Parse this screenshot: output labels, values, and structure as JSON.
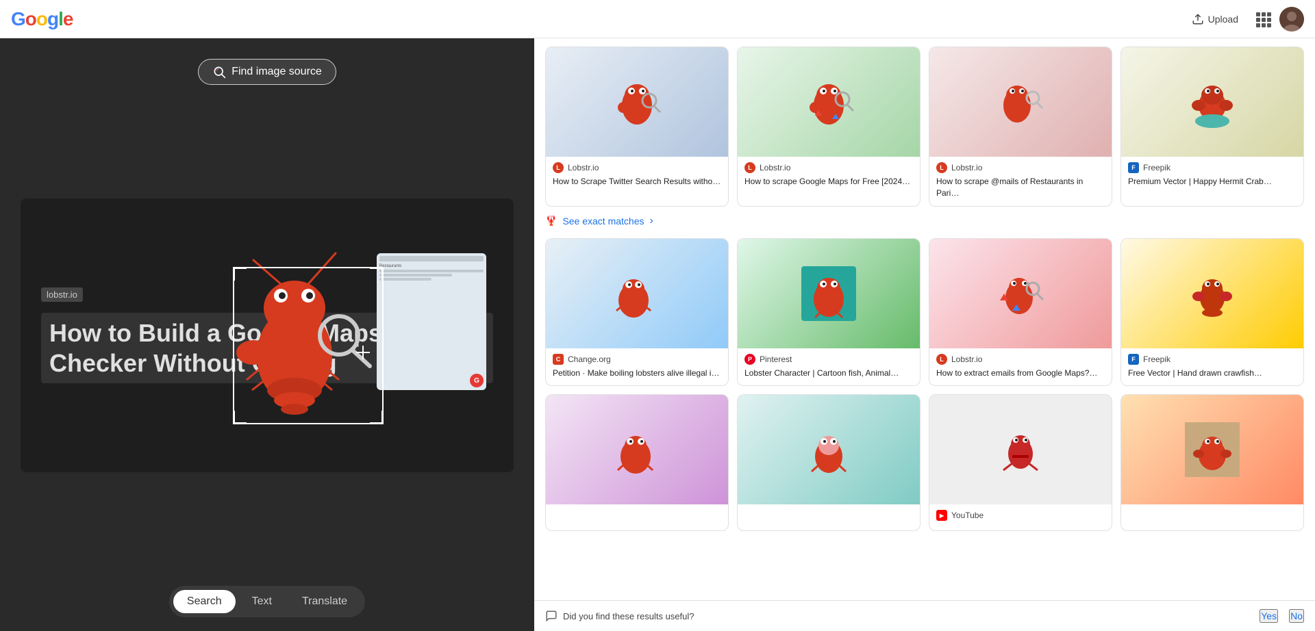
{
  "header": {
    "logo": "Google",
    "logo_letters": [
      "G",
      "o",
      "o",
      "g",
      "l",
      "e"
    ],
    "upload_label": "Upload",
    "upload_icon": "upload-icon",
    "grid_icon": "grid-icon",
    "avatar_icon": "user-avatar"
  },
  "left_panel": {
    "find_image_source_label": "Find image source",
    "image_tag": "lobstr.io",
    "image_headline": "How to Build a Google Maps Rank Checker Without Coding",
    "tabs": [
      {
        "id": "search",
        "label": "Search",
        "active": true
      },
      {
        "id": "text",
        "label": "Text",
        "active": false
      },
      {
        "id": "translate",
        "label": "Translate",
        "active": false
      }
    ]
  },
  "right_panel": {
    "see_exact_matches_label": "See exact matches",
    "results": [
      {
        "id": 1,
        "source_name": "Lobstr.io",
        "title": "How to Scrape Twitter Search Results witho…",
        "favicon_color": "#d63b1f",
        "favicon_letter": "L",
        "bg_class": "img-bg-1"
      },
      {
        "id": 2,
        "source_name": "Lobstr.io",
        "title": "How to scrape Google Maps for Free [2024…",
        "favicon_color": "#d63b1f",
        "favicon_letter": "L",
        "bg_class": "img-bg-2"
      },
      {
        "id": 3,
        "source_name": "Lobstr.io",
        "title": "How to scrape @mails of Restaurants in Pari…",
        "favicon_color": "#d63b1f",
        "favicon_letter": "L",
        "bg_class": "img-bg-3"
      },
      {
        "id": 4,
        "source_name": "Freepik",
        "title": "Premium Vector | Happy Hermit Crab…",
        "favicon_color": "#1565c0",
        "favicon_letter": "F",
        "bg_class": "img-bg-4"
      },
      {
        "id": 5,
        "source_name": "Change.org",
        "title": "Petition · Make boiling lobsters alive illegal i…",
        "favicon_color": "#d63b1f",
        "favicon_letter": "C",
        "bg_class": "img-bg-5"
      },
      {
        "id": 6,
        "source_name": "Pinterest",
        "title": "Lobster Character | Cartoon fish, Animal…",
        "favicon_color": "#e60023",
        "favicon_letter": "P",
        "bg_class": "img-bg-6"
      },
      {
        "id": 7,
        "source_name": "Lobstr.io",
        "title": "How to extract emails from Google Maps?…",
        "favicon_color": "#d63b1f",
        "favicon_letter": "L",
        "bg_class": "img-bg-7"
      },
      {
        "id": 8,
        "source_name": "Freepik",
        "title": "Free Vector | Hand drawn crawfish…",
        "favicon_color": "#1565c0",
        "favicon_letter": "F",
        "bg_class": "img-bg-8"
      },
      {
        "id": 9,
        "source_name": "",
        "title": "",
        "favicon_color": "#888",
        "favicon_letter": "",
        "bg_class": "img-bg-9"
      },
      {
        "id": 10,
        "source_name": "",
        "title": "",
        "favicon_color": "#888",
        "favicon_letter": "",
        "bg_class": "img-bg-10"
      },
      {
        "id": 11,
        "source_name": "YouTube",
        "title": "",
        "favicon_color": "#ff0000",
        "favicon_letter": "Y",
        "bg_class": "img-bg-11"
      },
      {
        "id": 12,
        "source_name": "",
        "title": "",
        "favicon_color": "#888",
        "favicon_letter": "",
        "bg_class": "img-bg-12"
      }
    ],
    "feedback": {
      "question": "Did you find these results useful?",
      "yes_label": "Yes",
      "no_label": "No"
    }
  }
}
